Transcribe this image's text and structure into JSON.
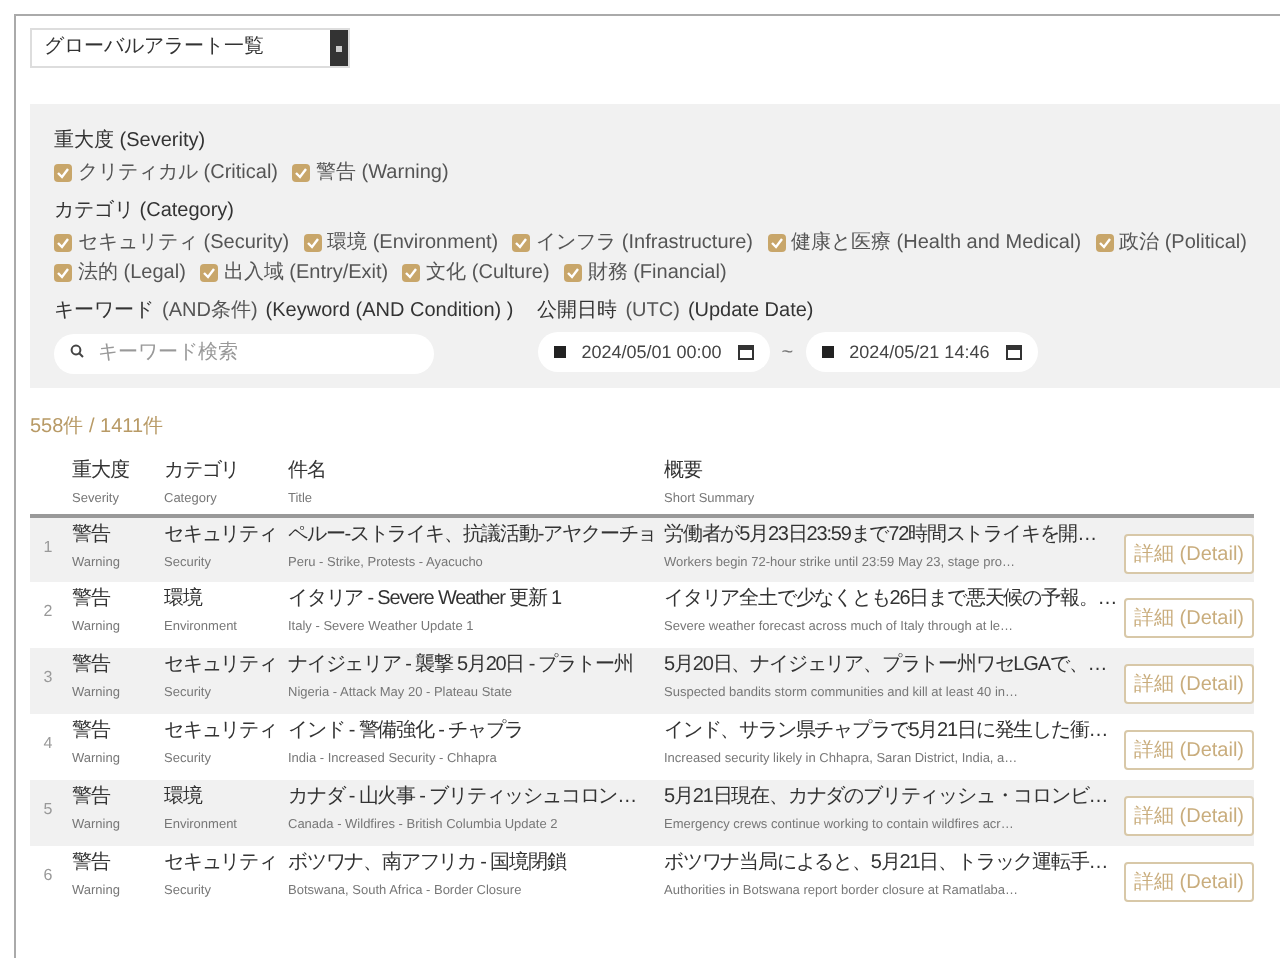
{
  "view_select": {
    "value": "グローバルアラート一覧"
  },
  "filters": {
    "severity": {
      "label": "重大度 (Severity)",
      "options": [
        {
          "label": "クリティカル (Critical)",
          "checked": true
        },
        {
          "label": "警告 (Warning)",
          "checked": true
        }
      ]
    },
    "category": {
      "label": "カテゴリ (Category)",
      "options": [
        {
          "label": "セキュリティ (Security)",
          "checked": true
        },
        {
          "label": "環境 (Environment)",
          "checked": true
        },
        {
          "label": "インフラ (Infrastructure)",
          "checked": true
        },
        {
          "label": "健康と医療 (Health and Medical)",
          "checked": true
        },
        {
          "label": "政治 (Political)",
          "checked": true
        },
        {
          "label": "法的 (Legal)",
          "checked": true
        },
        {
          "label": "出入域 (Entry/Exit)",
          "checked": true
        },
        {
          "label": "文化 (Culture)",
          "checked": true
        },
        {
          "label": "財務 (Financial)",
          "checked": true
        }
      ]
    },
    "keyword": {
      "label": "キーワード",
      "label_note": "(AND条件)",
      "label_en": "(Keyword (AND Condition) )",
      "placeholder": "キーワード検索"
    },
    "date": {
      "label": "公開日時",
      "label_note": "(UTC)",
      "label_en": "(Update Date)",
      "from": "2024/05/01 00:00",
      "separator": "~",
      "to": "2024/05/21 14:46"
    }
  },
  "count": "558件 / 1411件",
  "table": {
    "columns": [
      {
        "ja": "重大度",
        "en": "Severity"
      },
      {
        "ja": "カテゴリ",
        "en": "Category"
      },
      {
        "ja": "件名",
        "en": "Title"
      },
      {
        "ja": "概要",
        "en": "Short Summary"
      }
    ],
    "rows": [
      {
        "index": "1",
        "severity": "警告",
        "severity_en": "Warning",
        "category": "セキュリティ",
        "category_en": "Security",
        "title": "ペルー-ストライキ、抗議活動-アヤクーチョ",
        "title_en": "Peru - Strike, Protests - Ayacucho",
        "summary": "労働者が5月23日23:59まで72時間ストライキを開…",
        "summary_en": "Workers begin 72-hour strike until 23:59 May 23, stage pro…",
        "button": "詳細 (Detail)"
      },
      {
        "index": "2",
        "severity": "警告",
        "severity_en": "Warning",
        "category": "環境",
        "category_en": "Environment",
        "title": "イタリア - Severe Weather 更新 1",
        "title_en": "Italy - Severe Weather Update 1",
        "summary": "イタリア全土で少なくとも26日まで悪天候の予報。…",
        "summary_en": "Severe weather forecast across much of Italy through at le…",
        "button": "詳細 (Detail)"
      },
      {
        "index": "3",
        "severity": "警告",
        "severity_en": "Warning",
        "category": "セキュリティ",
        "category_en": "Security",
        "title": "ナイジェリア - 襲撃 5月20日 - プラトー州",
        "title_en": "Nigeria - Attack May 20 - Plateau State",
        "summary": "5月20日、ナイジェリア、プラトー州ワセLGAで、…",
        "summary_en": "Suspected bandits storm communities and kill at least 40 in…",
        "button": "詳細 (Detail)"
      },
      {
        "index": "4",
        "severity": "警告",
        "severity_en": "Warning",
        "category": "セキュリティ",
        "category_en": "Security",
        "title": "インド - 警備強化 - チャプラ",
        "title_en": "India - Increased Security - Chhapra",
        "summary": "インド、サラン県チャプラで5月21日に発生した衝…",
        "summary_en": "Increased security likely in Chhapra, Saran District, India, a…",
        "button": "詳細 (Detail)"
      },
      {
        "index": "5",
        "severity": "警告",
        "severity_en": "Warning",
        "category": "環境",
        "category_en": "Environment",
        "title": "カナダ - 山火事 - ブリティッシュコロン…",
        "title_en": "Canada - Wildfires - British Columbia Update 2",
        "summary": "5月21日現在、カナダのブリティッシュ・コロンビ…",
        "summary_en": "Emergency crews continue working to contain wildfires acr…",
        "button": "詳細 (Detail)"
      },
      {
        "index": "6",
        "severity": "警告",
        "severity_en": "Warning",
        "category": "セキュリティ",
        "category_en": "Security",
        "title": "ボツワナ、南アフリカ - 国境閉鎖",
        "title_en": "Botswana, South Africa - Border Closure",
        "summary": "ボツワナ当局によると、5月21日、トラック運転手…",
        "summary_en": "Authorities in Botswana report border closure at Ramatlaba…",
        "button": "詳細 (Detail)"
      }
    ]
  }
}
